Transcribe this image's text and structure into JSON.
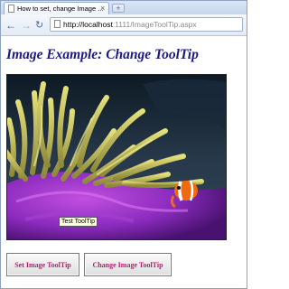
{
  "browser": {
    "tab_title": "How to set, change Image ...",
    "tab_close": "×",
    "new_tab": "+",
    "url_host": "http://localhost",
    "url_rest": ":1111/ImageToolTip.aspx"
  },
  "page": {
    "heading": "Image Example: Change ToolTip",
    "tooltip": "Test ToolTip",
    "buttons": {
      "set": "Set Image ToolTip",
      "change": "Change Image ToolTip"
    }
  },
  "colors": {
    "heading": "#1a1a80",
    "button_text": "#c0167a",
    "tooltip_bg": "#ffffe1"
  },
  "icons": {
    "back": "back-arrow-icon",
    "forward": "forward-arrow-icon",
    "reload": "reload-icon",
    "page": "page-icon"
  }
}
